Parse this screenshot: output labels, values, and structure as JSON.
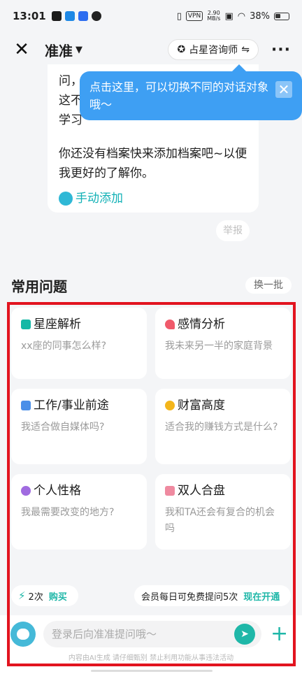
{
  "status_bar": {
    "time": "13:01",
    "vpn": "VPN",
    "speed_value": "2.90",
    "speed_unit": "MB/s",
    "battery": "38%"
  },
  "header": {
    "title": "准准",
    "switch_label": "占星咨询师"
  },
  "message": {
    "line1": "问，",
    "line2": "这不",
    "line3": "学习",
    "body": "你还没有档案快来添加档案吧~以便我更好的了解你。",
    "add_link": "手动添加"
  },
  "tooltip": {
    "text": "点击这里，可以切换不同的对话对象哦～"
  },
  "report_label": "举报",
  "faq": {
    "title": "常用问题",
    "refresh": "换一批",
    "items": [
      {
        "title": "星座解析",
        "desc": "xx座的同事怎么样?",
        "icon": "book-icon",
        "color": "#14b8a6"
      },
      {
        "title": "感情分析",
        "desc": "我未来另一半的家庭背景",
        "icon": "heart-icon",
        "color": "#f05a6b"
      },
      {
        "title": "工作/事业前途",
        "desc": "我适合做自媒体吗?",
        "icon": "briefcase-icon",
        "color": "#4b8fe8"
      },
      {
        "title": "财富高度",
        "desc": "适合我的赚钱方式是什么?",
        "icon": "coin-icon",
        "color": "#f3b51b"
      },
      {
        "title": "个人性格",
        "desc": "我最需要改变的地方?",
        "icon": "smile-icon",
        "color": "#a06be0"
      },
      {
        "title": "双人合盘",
        "desc": "我和TA还会有复合的机会吗",
        "icon": "couple-icon",
        "color": "#ef8aa0"
      }
    ]
  },
  "quota": {
    "count": "2次",
    "buy": "购买",
    "vip_text": "会员每日可免费提问5次",
    "vip_action": "现在开通"
  },
  "input": {
    "placeholder": "登录后向准准提问哦～",
    "disclaimer": "内容由AI生成 请仔细甄别 禁止利用功能从事违法活动"
  }
}
